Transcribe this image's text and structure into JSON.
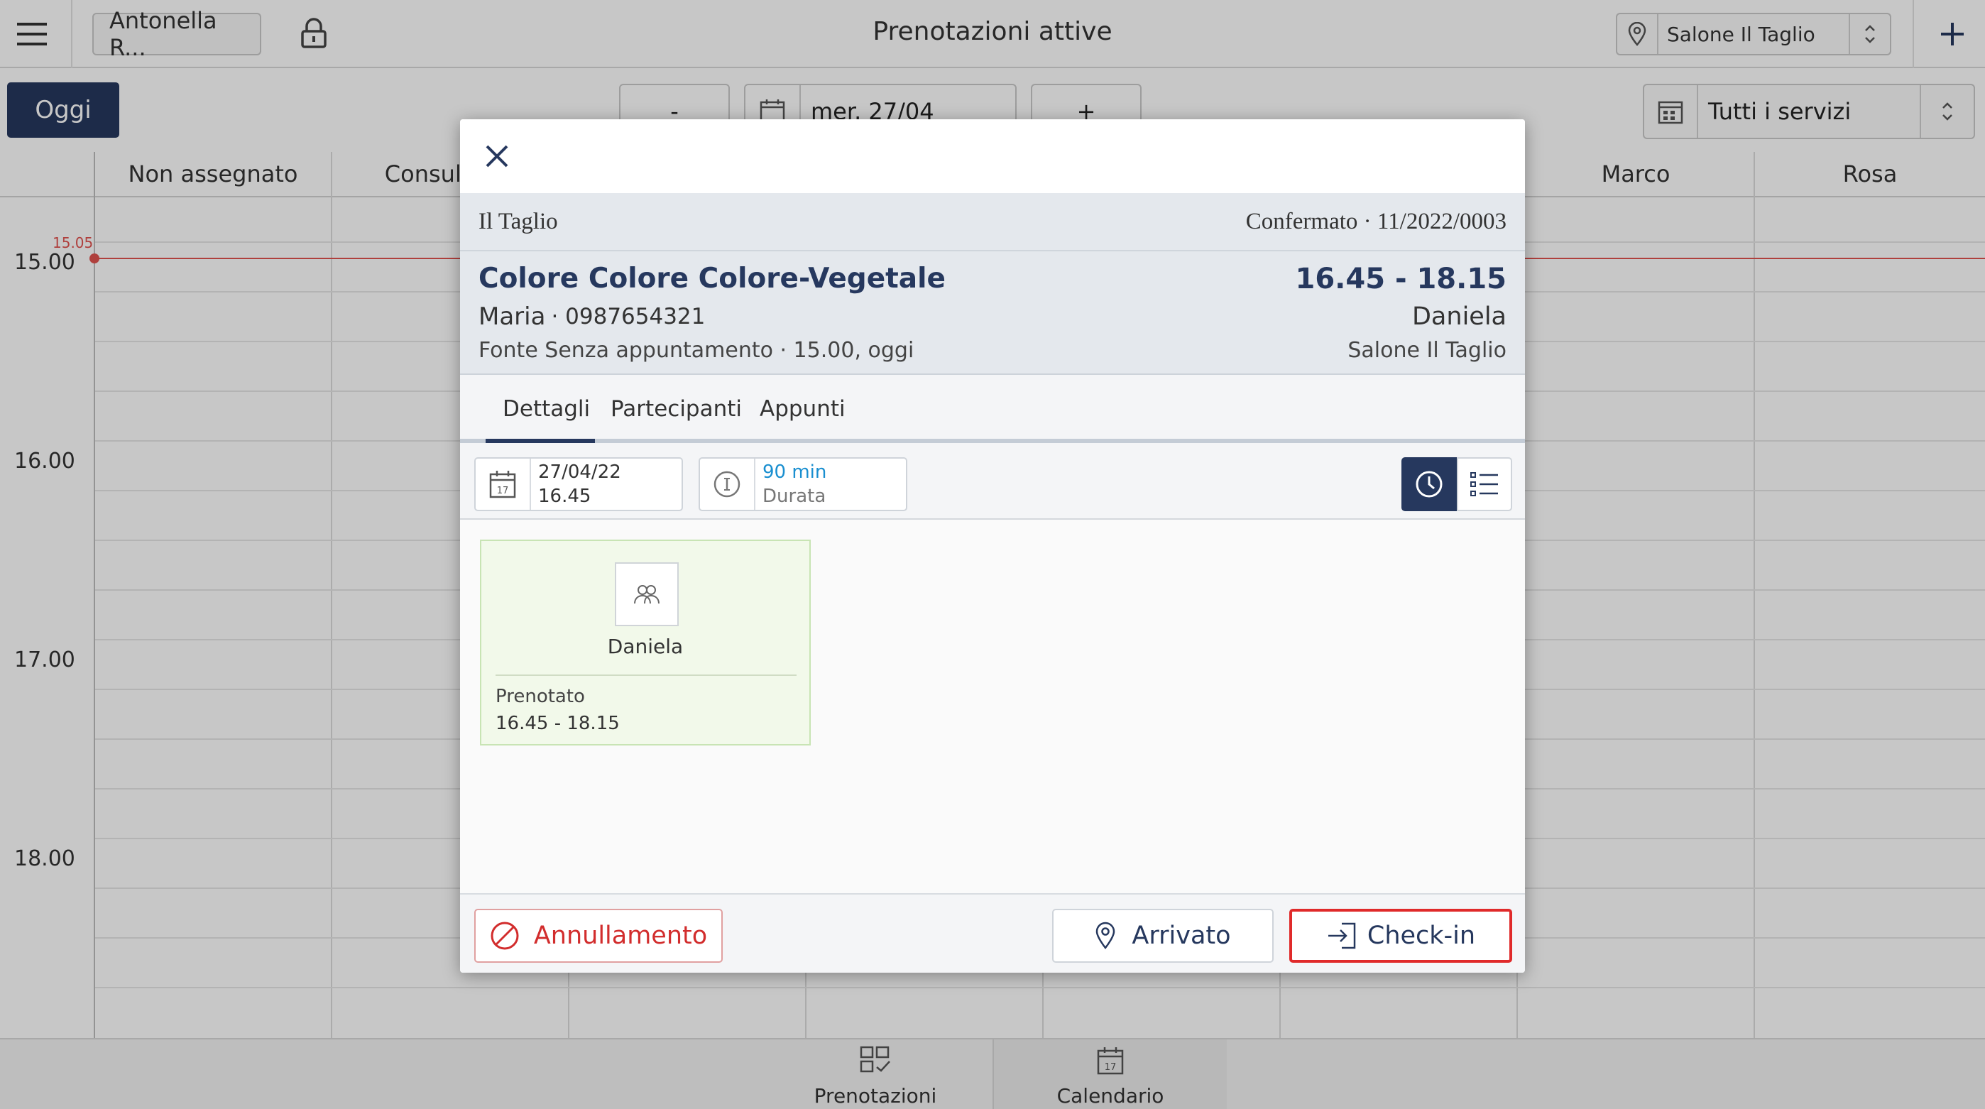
{
  "header": {
    "menu_icon": "hamburger-icon",
    "user_name": "Antonella R...",
    "lock_icon": "lock-icon",
    "page_title": "Prenotazioni attive",
    "location_icon": "map-pin-icon",
    "location_selected": "Salone Il Taglio",
    "add_icon": "plus-icon"
  },
  "toolbar": {
    "today_label": "Oggi",
    "prev_label": "-",
    "date_icon": "calendar-icon",
    "date_value": "mer. 27/04",
    "next_label": "+",
    "service_filter": "Tutti i servizi"
  },
  "calendar": {
    "columns": [
      "Non assegnato",
      "Consulenza",
      "",
      "",
      "",
      "",
      "Marco",
      "Rosa"
    ],
    "hours": [
      "15.00",
      "16.00",
      "17.00",
      "18.00"
    ],
    "now_marker": "15.05"
  },
  "bottom_nav": {
    "items": [
      {
        "label": "Prenotazioni",
        "icon": "bookings-icon"
      },
      {
        "label": "Calendario",
        "icon": "calendar-icon"
      }
    ]
  },
  "modal": {
    "close_icon": "close-icon",
    "salon": "Il Taglio",
    "status": "Confermato · 11/2022/0003",
    "service": "Colore Colore Colore-Vegetale",
    "time_range": "16.45 - 18.15",
    "client_name": "Maria",
    "client_phone": "· 0987654321",
    "staff": "Daniela",
    "source": "Fonte Senza appuntamento · 15.00, oggi",
    "location": "Salone Il Taglio",
    "tabs": [
      "Dettagli",
      "Partecipanti",
      "Appunti"
    ],
    "date_box": {
      "date": "27/04/22",
      "time": "16.45"
    },
    "duration_box": {
      "value": "90 min",
      "label": "Durata"
    },
    "card": {
      "staff": "Daniela",
      "status_label": "Prenotato",
      "time": "16.45 - 18.15"
    },
    "footer": {
      "cancel_label": "Annullamento",
      "arrived_label": "Arrivato",
      "checkin_label": "Check-in"
    }
  },
  "colors": {
    "navy": "#26385e",
    "accent_blue": "#1a8fd0",
    "danger_red": "#d22d2d",
    "now_line": "#e0524f",
    "card_green_bg": "#f2f9ea"
  }
}
